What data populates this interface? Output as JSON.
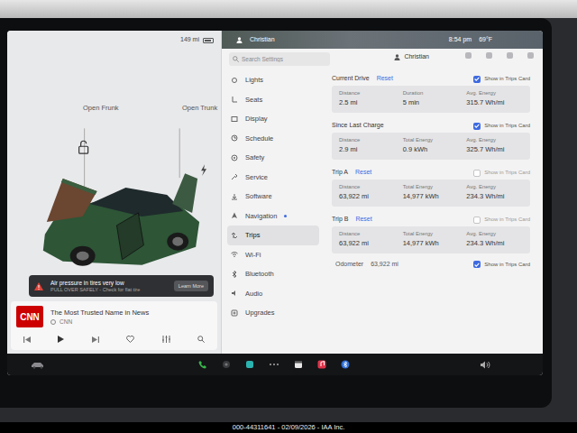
{
  "status": {
    "range": "149 mi"
  },
  "car": {
    "frunk_label": "Open Frunk",
    "trunk_label": "Open Trunk"
  },
  "alert": {
    "title": "Air pressure in tires very low",
    "subtitle": "PULL OVER SAFELY - Check for flat tire",
    "action": "Learn More"
  },
  "media": {
    "logo": "CNN",
    "title": "The Most Trusted Name in News",
    "source": "CNN"
  },
  "top_bar": {
    "user": "Christian",
    "time": "8:54 pm",
    "temp": "69°F"
  },
  "search": {
    "placeholder": "Search Settings"
  },
  "profile": {
    "name": "Christian"
  },
  "menu": [
    {
      "label": "Lights",
      "selected": false,
      "dot": false
    },
    {
      "label": "Seats",
      "selected": false,
      "dot": false
    },
    {
      "label": "Display",
      "selected": false,
      "dot": false
    },
    {
      "label": "Schedule",
      "selected": false,
      "dot": false
    },
    {
      "label": "Safety",
      "selected": false,
      "dot": false
    },
    {
      "label": "Service",
      "selected": false,
      "dot": false
    },
    {
      "label": "Software",
      "selected": false,
      "dot": false
    },
    {
      "label": "Navigation",
      "selected": false,
      "dot": true
    },
    {
      "label": "Trips",
      "selected": true,
      "dot": false
    },
    {
      "label": "Wi-Fi",
      "selected": false,
      "dot": false
    },
    {
      "label": "Bluetooth",
      "selected": false,
      "dot": false
    },
    {
      "label": "Audio",
      "selected": false,
      "dot": false
    },
    {
      "label": "Upgrades",
      "selected": false,
      "dot": false
    }
  ],
  "sections": [
    {
      "title": "Current Drive",
      "reset": "Reset",
      "show_label": "Show in Trips Card",
      "checked": true,
      "stats": [
        {
          "label": "Distance",
          "value": "2.5 mi"
        },
        {
          "label": "Duration",
          "value": "5 min"
        },
        {
          "label": "Avg. Energy",
          "value": "315.7 Wh/mi"
        }
      ]
    },
    {
      "title": "Since Last Charge",
      "reset": "",
      "show_label": "Show in Trips Card",
      "checked": true,
      "stats": [
        {
          "label": "Distance",
          "value": "2.9 mi"
        },
        {
          "label": "Total Energy",
          "value": "0.9 kWh"
        },
        {
          "label": "Avg. Energy",
          "value": "325.7 Wh/mi"
        }
      ]
    },
    {
      "title": "Trip A",
      "reset": "Reset",
      "show_label": "Show in Trips Card",
      "checked": false,
      "stats": [
        {
          "label": "Distance",
          "value": "63,922 mi"
        },
        {
          "label": "Total Energy",
          "value": "14,977 kWh"
        },
        {
          "label": "Avg. Energy",
          "value": "234.3 Wh/mi"
        }
      ]
    },
    {
      "title": "Trip B",
      "reset": "Reset",
      "show_label": "Show in Trips Card",
      "checked": false,
      "stats": [
        {
          "label": "Distance",
          "value": "63,922 mi"
        },
        {
          "label": "Total Energy",
          "value": "14,977 kWh"
        },
        {
          "label": "Avg. Energy",
          "value": "234.3 Wh/mi"
        }
      ]
    }
  ],
  "odometer": {
    "label": "Odometer",
    "value": "63,922 mi",
    "show_label": "Show in Trips Card",
    "checked": true
  },
  "watermark": "000-44311641 - 02/09/2026 - IAA Inc."
}
